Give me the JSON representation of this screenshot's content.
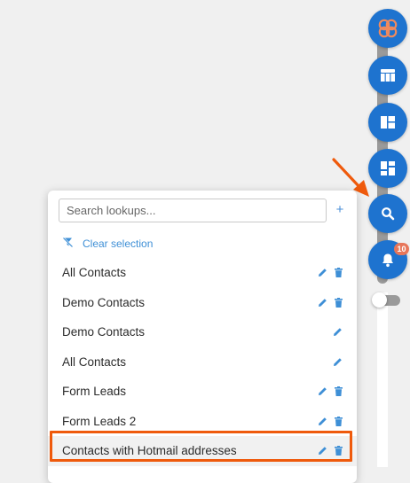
{
  "rail": {
    "buttons": [
      {
        "icon": "brand-logo-icon"
      },
      {
        "icon": "table-icon"
      },
      {
        "icon": "dashboard-layout-icon"
      },
      {
        "icon": "widgets-icon"
      },
      {
        "icon": "search-icon"
      },
      {
        "icon": "bell-icon",
        "badge": "10"
      }
    ]
  },
  "lookups": {
    "search_placeholder": "Search lookups...",
    "add_label": "+",
    "clear_label": "Clear selection",
    "items": [
      {
        "label": "All Contacts",
        "editable": true,
        "deletable": true
      },
      {
        "label": "Demo Contacts",
        "editable": true,
        "deletable": true
      },
      {
        "label": "Demo Contacts",
        "editable": true,
        "deletable": false
      },
      {
        "label": "All Contacts",
        "editable": true,
        "deletable": false
      },
      {
        "label": "Form Leads",
        "editable": true,
        "deletable": true
      },
      {
        "label": "Form Leads 2",
        "editable": true,
        "deletable": true
      },
      {
        "label": "Contacts with Hotmail addresses",
        "editable": true,
        "deletable": true,
        "highlighted": true
      }
    ]
  },
  "colors": {
    "rail_button": "#1e73cf",
    "accent": "#3e8fd6",
    "highlight": "#ef5a0c",
    "badge": "#e7765a"
  }
}
